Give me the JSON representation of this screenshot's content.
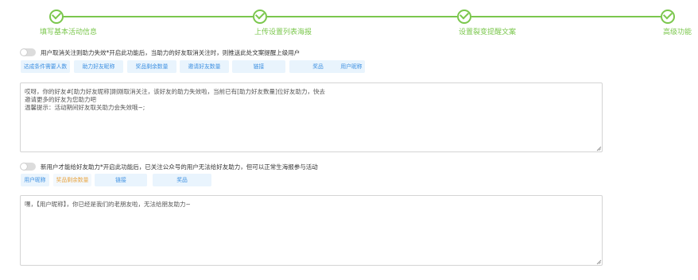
{
  "steps": [
    {
      "label": "填写基本活动信息"
    },
    {
      "label": "上传设置列表海报"
    },
    {
      "label": "设置裂变提醒文案"
    },
    {
      "label": "高级功能"
    }
  ],
  "section1": {
    "toggle_text": "用户取消关注则助力失效*开启此功能后，当助力的好友取消关注时，则推送此处文案提醒上级用户",
    "tags": [
      "达成条件需要人数",
      "助力好友昵称",
      "奖品剩余数量",
      "邀请好友数量",
      "链接",
      "奖品",
      "用户昵称"
    ],
    "message_lines": [
      "哎呀，你的好友#[助力好友昵称]刚刚取消关注，该好友的助力失效啦，当前已有[助力好友数量]位好友助力，快去",
      "邀请更多的好友为您助力吧",
      "温馨提示：活动期间好友取关助力会失效哦~;"
    ]
  },
  "section2": {
    "toggle_text": "新用户才能给好友助力*开启此功能后，已关注公众号的用户无法给好友助力，但可以正常生海报参与活动",
    "tags": [
      "用户昵称",
      "奖品剩余数量",
      "链接",
      "奖品"
    ],
    "message_lines": [
      "嘿，【用户昵称】，你已经是我们的老朋友啦，无法给朋友助力~"
    ]
  },
  "colors": {
    "accent": "#7bc74d",
    "tag_blue": "#3c8fe1",
    "tag_orange": "#e8a33d"
  }
}
